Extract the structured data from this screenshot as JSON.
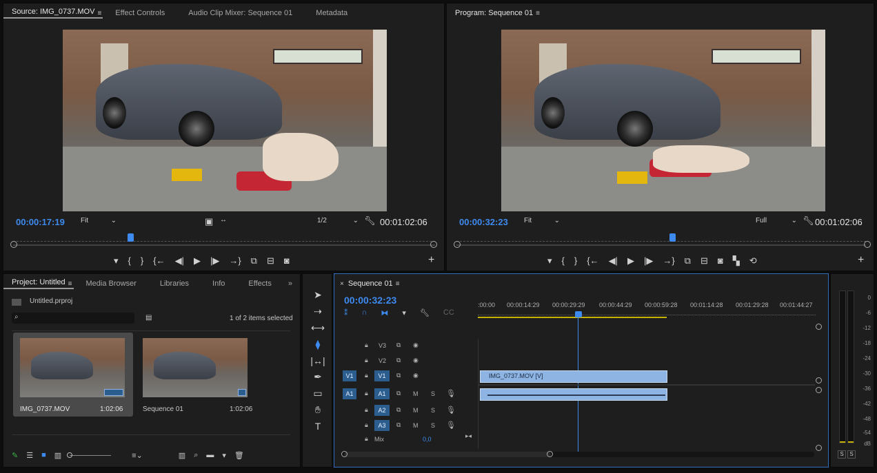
{
  "source": {
    "tabs": [
      "Source: IMG_0737.MOV",
      "Effect Controls",
      "Audio Clip Mixer: Sequence 01",
      "Metadata"
    ],
    "timecode": "00:00:17:19",
    "zoom": "Fit",
    "resolution": "1/2",
    "duration": "00:01:02:06",
    "playhead_fraction": 0.28
  },
  "program": {
    "tab": "Program: Sequence 01",
    "timecode": "00:00:32:23",
    "zoom": "Fit",
    "resolution": "Full",
    "duration": "00:01:02:06",
    "playhead_fraction": 0.51
  },
  "project": {
    "tabs": [
      "Project: Untitled",
      "Media Browser",
      "Libraries",
      "Info",
      "Effects"
    ],
    "file": "Untitled.prproj",
    "selection": "1 of 2 items selected",
    "items": [
      {
        "name": "IMG_0737.MOV",
        "duration": "1:02:06"
      },
      {
        "name": "Sequence 01",
        "duration": "1:02:06"
      }
    ]
  },
  "timeline": {
    "tab": "Sequence 01",
    "timecode": "00:00:32:23",
    "ruler": [
      ":00:00",
      "00:00:14:29",
      "00:00:29:29",
      "00:00:44:29",
      "00:00:59:28",
      "00:01:14:28",
      "00:01:29:28",
      "00:01:44:27"
    ],
    "video_tracks": [
      "V3",
      "V2",
      "V1"
    ],
    "audio_tracks": [
      "A1",
      "A2",
      "A3"
    ],
    "src_v": "V1",
    "src_a": "A1",
    "mix_label": "Mix",
    "mix_value": "0,0",
    "clip_video": "IMG_0737.MOV [V]",
    "m": "M",
    "s": "S"
  },
  "meter": {
    "scale": [
      "0",
      "-6",
      "-12",
      "-18",
      "-24",
      "-30",
      "-36",
      "-42",
      "-48",
      "-54",
      "dB"
    ],
    "solo": [
      "S",
      "S"
    ]
  },
  "colors": {
    "accent": "#3d8bf0",
    "clip_video": "#8db4e2",
    "clip_audio": "#8db4e2",
    "work_area": "#c8b400"
  }
}
